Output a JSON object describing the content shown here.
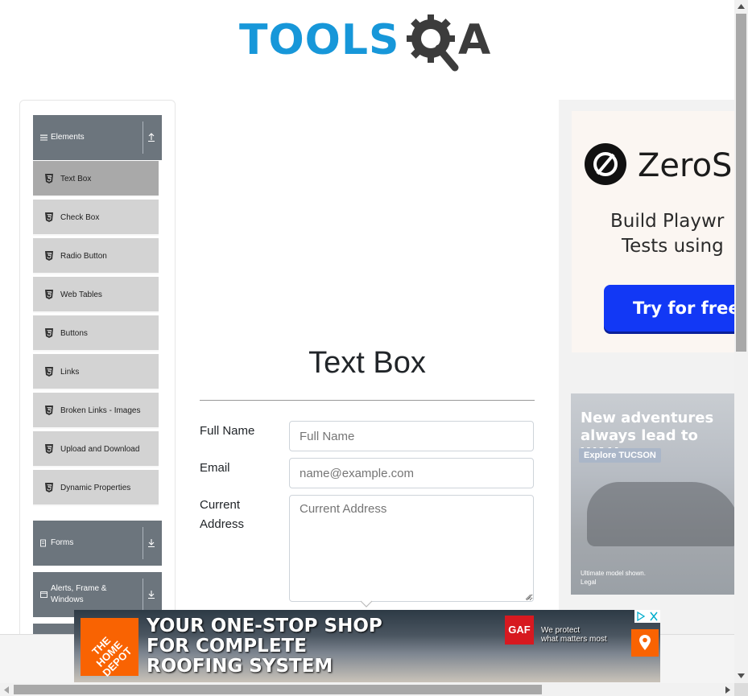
{
  "header": {
    "logo_word": "TOOLS",
    "logo_letter": "A",
    "colors": {
      "logo_blue": "#1797d9",
      "logo_dark": "#3c3c3c"
    }
  },
  "sidebar": {
    "groups": [
      {
        "label": "Elements",
        "icon": "hamburger-icon",
        "arrow": "collapse-up-icon"
      },
      {
        "label": "Forms",
        "icon": "form-icon",
        "arrow": "expand-down-icon"
      },
      {
        "label": "Alerts, Frame & Windows",
        "icon": "window-icon",
        "arrow": "expand-down-icon"
      }
    ],
    "items": [
      {
        "label": "Text Box",
        "active": true
      },
      {
        "label": "Check Box"
      },
      {
        "label": "Radio Button"
      },
      {
        "label": "Web Tables"
      },
      {
        "label": "Buttons"
      },
      {
        "label": "Links"
      },
      {
        "label": "Broken Links - Images"
      },
      {
        "label": "Upload and Download"
      },
      {
        "label": "Dynamic Properties"
      }
    ],
    "colors": {
      "header_bg": "#6c757d",
      "item_bg": "#d3d3d3",
      "active_bg": "#a9a9a9"
    }
  },
  "main": {
    "title": "Text Box",
    "fields": {
      "full_name": {
        "label": "Full Name",
        "placeholder": "Full Name",
        "value": ""
      },
      "email": {
        "label": "Email",
        "placeholder": "name@example.com",
        "value": ""
      },
      "address": {
        "label_line1": "Current",
        "label_line2": "Address",
        "placeholder": "Current Address",
        "value": ""
      }
    }
  },
  "ads": {
    "right_top": {
      "brand": "ZeroS",
      "line1": "Build Playwr",
      "line2": "Tests using",
      "button": "Try for free",
      "colors": {
        "button": "#1238f5"
      }
    },
    "right_bottom": {
      "headline_line1": "New adventures",
      "headline_line2": "always lead to WAH.",
      "button": "Explore TUCSON",
      "fine_line1": "Ultimate model shown.",
      "fine_line2": "Legal"
    },
    "bottom": {
      "brand_logo": "THE HOME DEPOT",
      "line1": "YOUR ONE-STOP SHOP",
      "line2": "FOR COMPLETE",
      "line3": "ROOFING SYSTEM",
      "gaf": "GAF",
      "tag_line1": "We protect",
      "tag_line2": "what matters most",
      "colors": {
        "home_depot_orange": "#f96302",
        "gaf_red": "#d71920"
      }
    }
  }
}
